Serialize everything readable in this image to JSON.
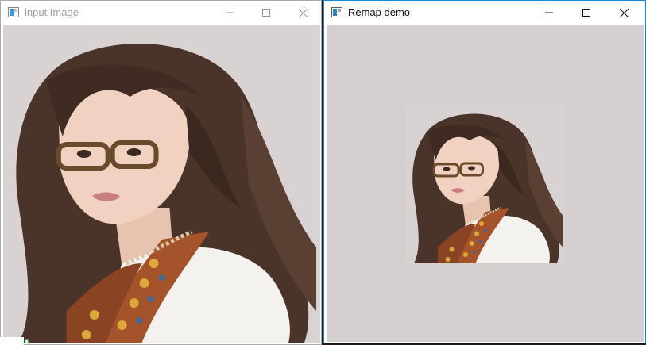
{
  "windows": {
    "input": {
      "title": "input Image",
      "active": false,
      "controls": {
        "minimize": "minimize-icon",
        "maximize": "maximize-icon",
        "close": "close-icon"
      }
    },
    "remap": {
      "title": "Remap demo",
      "active": true,
      "scale": 0.5,
      "controls": {
        "minimize": "minimize-icon",
        "maximize": "maximize-icon",
        "close": "close-icon"
      }
    }
  },
  "colors": {
    "active_border": "#1883d7",
    "inactive_border": "#aaaaaa",
    "inactive_title": "#a0a0a0",
    "active_title": "#111111",
    "remap_background": "#d6cfcf"
  },
  "image": {
    "subject": "portrait-photo",
    "description_icon": "photo-icon"
  }
}
